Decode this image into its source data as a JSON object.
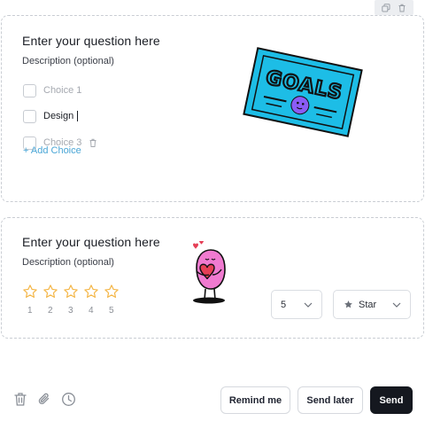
{
  "toolbar": {
    "icons": [
      "copy-icon",
      "trash-icon"
    ]
  },
  "question1": {
    "title": "Enter your question here",
    "description": "Description (optional)",
    "choices": [
      {
        "label": "Choice 1",
        "active": false
      },
      {
        "label": "Design",
        "active": true
      },
      {
        "label": "Choice 3",
        "active": false
      }
    ],
    "add_choice": "+ Add Choice",
    "sticker": {
      "text": "GOALS",
      "colors": {
        "frame": "#1dbde6",
        "ink": "#111111",
        "blob": "#8a5cf6"
      }
    }
  },
  "question2": {
    "title": "Enter your question here",
    "description": "Description (optional)",
    "rating": {
      "labels": [
        "1",
        "2",
        "3",
        "4",
        "5"
      ],
      "star_color": "#f4b647"
    },
    "count_select": "5",
    "type_select": "Star",
    "sticker": {
      "name": "heart-hug-sticker",
      "colors": {
        "body": "#f07ad0",
        "heart": "#e53e55"
      }
    }
  },
  "footer": {
    "icons": [
      "trash-icon",
      "paperclip-icon",
      "clock-icon"
    ],
    "remind": "Remind me",
    "send_later": "Send later",
    "send": "Send"
  }
}
